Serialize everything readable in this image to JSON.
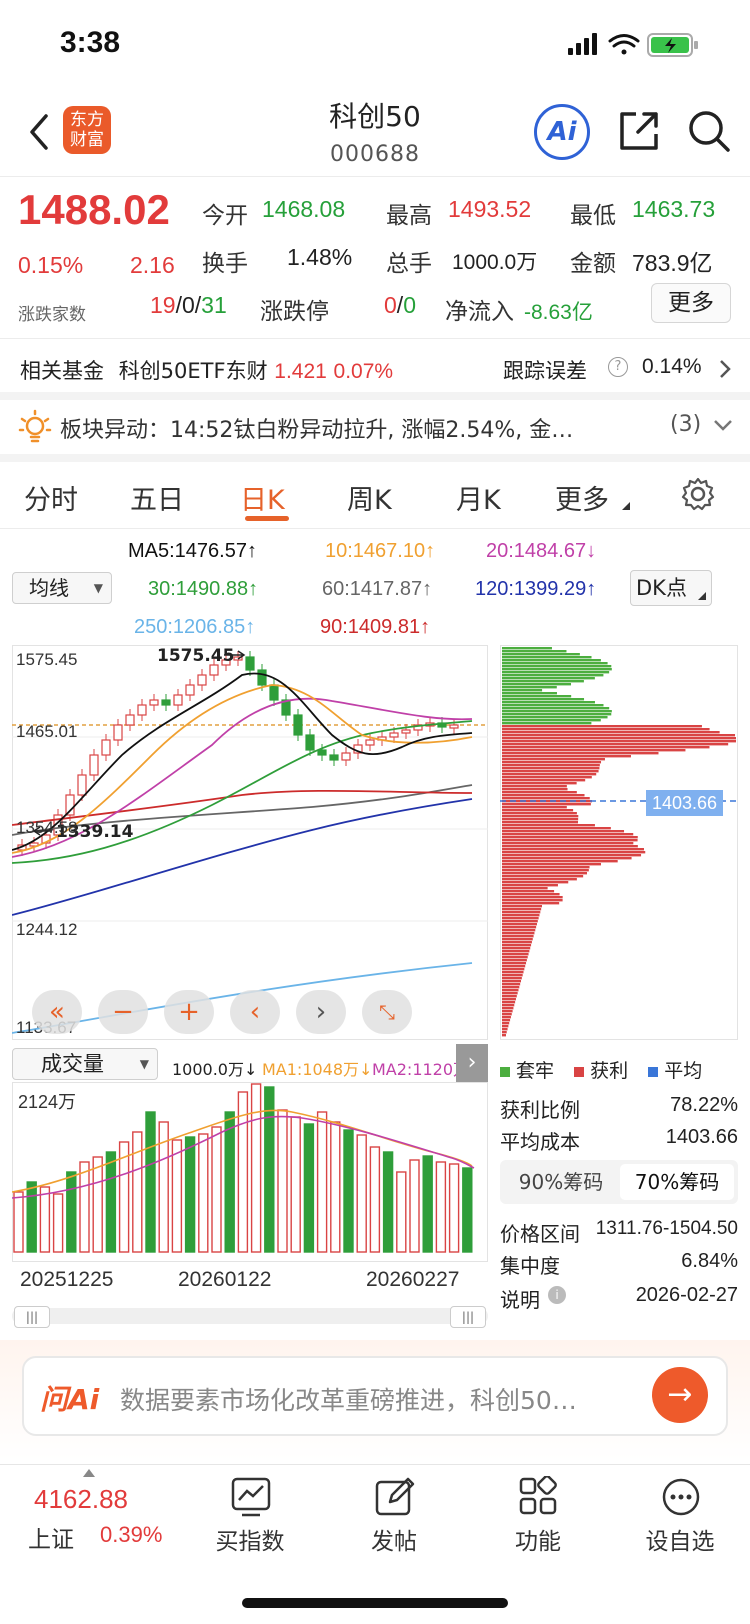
{
  "status": {
    "time": "3:38"
  },
  "header": {
    "brand_line1": "东方",
    "brand_line2": "财富",
    "title": "科创50",
    "code": "000688",
    "ai_label": "Ai"
  },
  "quote": {
    "price": "1488.02",
    "change_pct": "0.15%",
    "change": "2.16",
    "open_label": "今开",
    "open": "1468.08",
    "high_label": "最高",
    "high": "1493.52",
    "low_label": "最低",
    "low": "1463.73",
    "turnover_label": "换手",
    "turnover": "1.48%",
    "volume_label": "总手",
    "volume": "1000.0万",
    "amount_label": "金额",
    "amount": "783.9亿",
    "breadth_label": "涨跌家数",
    "breadth_up": "19",
    "breadth_flat": "0",
    "breadth_down": "31",
    "limit_label": "涨跌停",
    "limit_up": "0",
    "limit_down": "0",
    "netflow_label": "净流入",
    "netflow": "-8.63亿",
    "more_label": "更多"
  },
  "fund": {
    "label": "相关基金",
    "name": "科创50ETF东财",
    "price": "1.421",
    "pct": "0.07%",
    "tracking_label": "跟踪误差",
    "tracking": "0.14%"
  },
  "alert": {
    "text": "板块异动：14:52钛白粉异动拉升, 涨幅2.54%, 金…",
    "count": "(3)"
  },
  "tabs": [
    "分时",
    "五日",
    "日K",
    "周K",
    "月K",
    "更多"
  ],
  "ma": {
    "selector": "均线",
    "dk": "DK点",
    "items": [
      {
        "text": "MA5:1476.57↑",
        "color": "#111111"
      },
      {
        "text": "10:1467.10↑",
        "color": "#f0a030"
      },
      {
        "text": "20:1484.67↓",
        "color": "#c040a8"
      },
      {
        "text": "30:1490.88↑",
        "color": "#2f9e3a"
      },
      {
        "text": "60:1417.87↑",
        "color": "#666666"
      },
      {
        "text": "120:1399.29↑",
        "color": "#2233aa"
      },
      {
        "text": "250:1206.85↑",
        "color": "#6ab4e8"
      },
      {
        "text": "90:1409.81↑",
        "color": "#cc2b2b"
      }
    ]
  },
  "kline": {
    "y_labels": [
      "1575.45",
      "1465.01",
      "1354.58",
      "1244.12",
      "1133.67"
    ],
    "peak_label": "1575.45",
    "trough_label": "1339.14",
    "cost_label": "1403.66"
  },
  "volume": {
    "selector": "成交量",
    "summary": "1000.0万↓",
    "ma1": "MA1:1048万↓",
    "ma2": "MA2:1120万↓",
    "max_label": "2124万",
    "dates": [
      "20251225",
      "20260122",
      "20260227"
    ]
  },
  "chips": {
    "legend": [
      {
        "label": "套牢",
        "color": "#4cae3f"
      },
      {
        "label": "获利",
        "color": "#d94444"
      },
      {
        "label": "平均",
        "color": "#3a76d8"
      }
    ],
    "profit_label": "获利比例",
    "profit": "78.22%",
    "avg_label": "平均成本",
    "avg": "1403.66",
    "tab1": "90%筹码",
    "tab2": "70%筹码",
    "range_label": "价格区间",
    "range": "1311.76-1504.50",
    "conc_label": "集中度",
    "conc": "6.84%",
    "note_label": "说明",
    "note_date": "2026-02-27"
  },
  "ask": {
    "logo": "问Ai",
    "placeholder": "数据要素市场化改革重磅推进，科创50…"
  },
  "bottom": {
    "index_value": "4162.88",
    "index_name": "上证",
    "index_pct": "0.39%",
    "items": [
      {
        "label": "买指数",
        "icon": "chart-icon"
      },
      {
        "label": "发帖",
        "icon": "edit-icon"
      },
      {
        "label": "功能",
        "icon": "grid-icon"
      },
      {
        "label": "设自选",
        "icon": "more-dots-icon"
      }
    ]
  }
}
